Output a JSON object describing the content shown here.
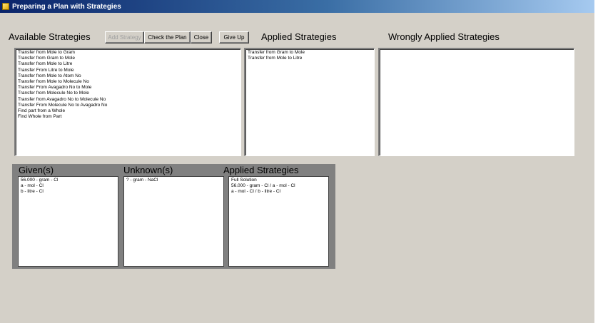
{
  "window": {
    "title": "Preparing a Plan with Strategies"
  },
  "headings": {
    "available": "Available Strategies",
    "applied": "Applied Strategies",
    "wrongly_applied": "Wrongly Applied Strategies"
  },
  "buttons": {
    "add_strategy": "Add Strategy",
    "check_plan": "Check the Plan",
    "close": "Close",
    "give_up": "Give Up"
  },
  "available_strategies": [
    "Transfer from Mole to Gram",
    "Transfer from Gram to Mole",
    "Transfer from Mole to Litre",
    "Transfer From Litre to Mole",
    "Transfer from Mole to Atom No",
    "Transfer from Mole to Molecule No",
    "Transfer From Avagadro No to Mole",
    "Transfer from Molecule No to Mole",
    "Transfer from Avagadro No to Molecule No",
    "Transfer From Molecule No to Avagadro No",
    "Find  part from a Whole",
    "Find Whole from Part"
  ],
  "applied_strategies": [
    "Transfer from Gram to Mole",
    "Transfer from Mole to Litre"
  ],
  "wrongly_applied_strategies": [],
  "bottom_panel": {
    "given_label": "Given(s)",
    "unknown_label": "Unknown(s)",
    "applied_label": "Applied Strategies",
    "givens": [
      "56.000 - gram - Cl",
      "a - mol - Cl",
      "b - litre - Cl"
    ],
    "unknowns": [
      "?  - gram - NaCl"
    ],
    "applied": [
      "Full Solution",
      "56.000 - gram - Cl /  a - mol - Cl",
      "a - mol - Cl /  b - litre - Cl"
    ]
  }
}
